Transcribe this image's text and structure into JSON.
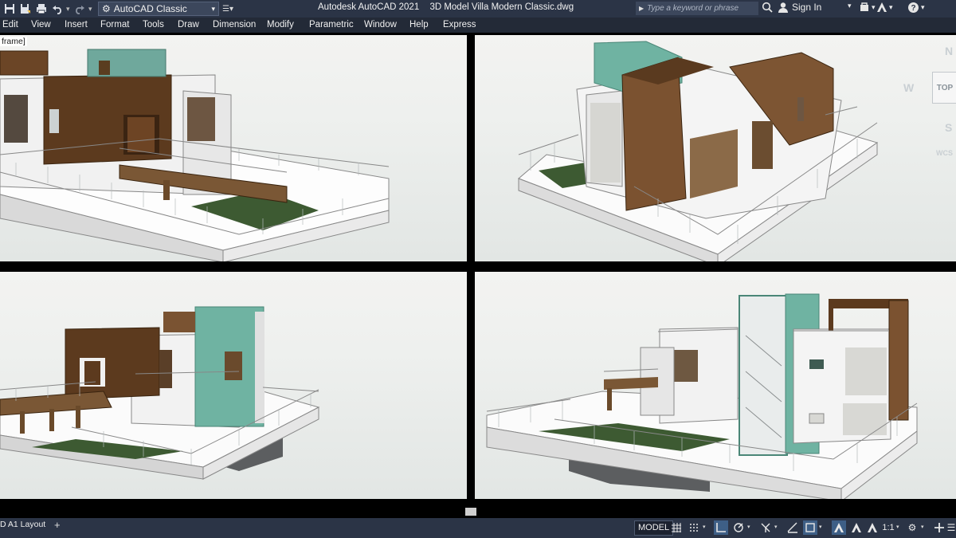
{
  "app": {
    "title": "Autodesk AutoCAD 2021",
    "document": "3D Model Villa Modern Classic.dwg"
  },
  "quick_access": {
    "workspace": "AutoCAD Classic",
    "icons": [
      "save-icon",
      "save-as-icon",
      "print-icon",
      "undo-icon",
      "redo-icon"
    ]
  },
  "search": {
    "placeholder": "Type a keyword or phrase"
  },
  "account": {
    "sign_in": "Sign In"
  },
  "menu": [
    "Edit",
    "View",
    "Insert",
    "Format",
    "Tools",
    "Draw",
    "Dimension",
    "Modify",
    "Parametric",
    "Window",
    "Help",
    "Express"
  ],
  "viewports": {
    "top_left_label": "frame]"
  },
  "viewcube": {
    "north": "N",
    "west": "W",
    "south": "S",
    "face": "TOP",
    "wcs": "WCS"
  },
  "layout": {
    "tab": "D A1 Layout",
    "add": "+"
  },
  "status": {
    "model": "MODEL",
    "scale": "1:1"
  }
}
